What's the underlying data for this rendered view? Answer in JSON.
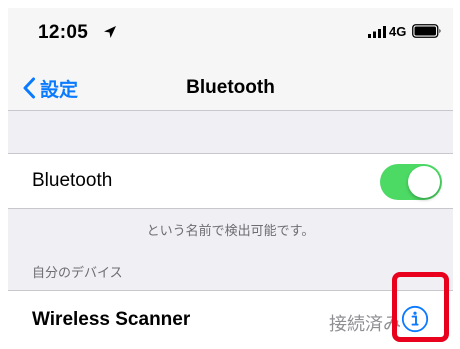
{
  "status_bar": {
    "time": "12:05",
    "network": "4G",
    "icons": [
      "location-arrow-icon",
      "signal-icon",
      "battery-icon"
    ]
  },
  "nav": {
    "back_label": "設定",
    "title": "Bluetooth"
  },
  "bluetooth_row": {
    "label": "Bluetooth",
    "toggle_on": true,
    "toggle_color": "#4cd964"
  },
  "discoverable_note": "という名前で検出可能です。",
  "my_devices": {
    "header": "自分のデバイス",
    "devices": [
      {
        "name": "Wireless Scanner",
        "status": "接続済み"
      }
    ]
  },
  "colors": {
    "accent": "#0a7aff",
    "highlight": "#e8001c"
  }
}
